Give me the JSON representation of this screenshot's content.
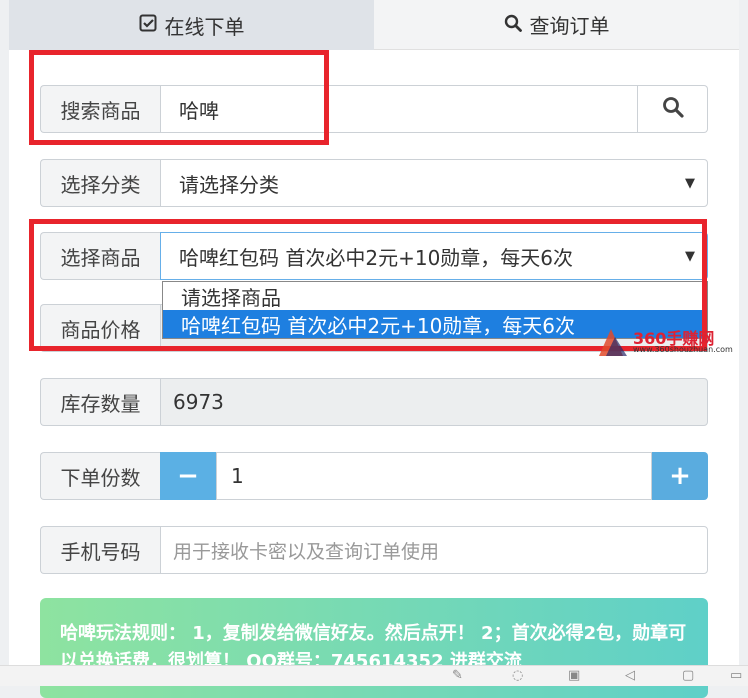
{
  "tabs": [
    {
      "label": "在线下单",
      "icon": "check-square-icon"
    },
    {
      "label": "查询订单",
      "icon": "search-icon"
    }
  ],
  "form": {
    "search": {
      "label": "搜索商品",
      "value": "哈啤"
    },
    "category": {
      "label": "选择分类",
      "value": "请选择分类"
    },
    "product": {
      "label": "选择商品",
      "value": "哈啤红包码 首次必中2元+10勋章，每天6次"
    },
    "price": {
      "label": "商品价格"
    },
    "stock": {
      "label": "库存数量",
      "value": "6973"
    },
    "quantity": {
      "label": "下单份数",
      "value": "1",
      "minus": "−",
      "plus": "+"
    },
    "phone": {
      "label": "手机号码",
      "placeholder": "用于接收卡密以及查询订单使用"
    }
  },
  "dropdown": {
    "options": [
      {
        "label": "请选择商品",
        "selected": false
      },
      {
        "label": "哈啤红包码 首次必中2元+10勋章，每天6次",
        "selected": true
      }
    ]
  },
  "notice": {
    "text": "哈啤玩法规则： 1，复制发给微信好友。然后点开！ 2；首次必得2包，勋章可以兑换话费，很划算！ QQ群号：745614352 进群交流"
  },
  "watermark": {
    "brand": "360手赚网",
    "url": "www.360shouzhuan.com"
  },
  "colors": {
    "accent": "#5aacdf",
    "annotation": "#e8242c",
    "selected": "#1e7fe0"
  }
}
